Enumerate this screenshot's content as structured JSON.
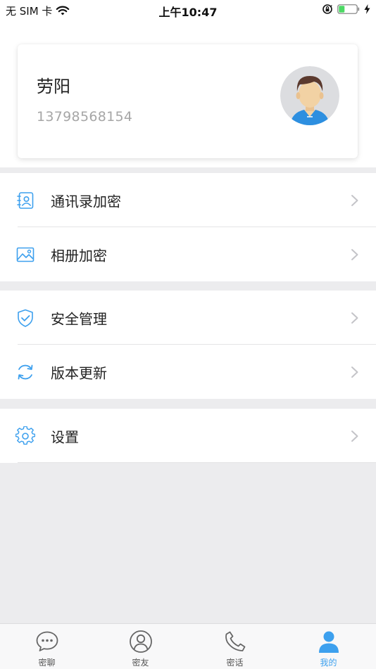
{
  "status_bar": {
    "carrier": "无 SIM 卡",
    "time": "上午10:47"
  },
  "profile": {
    "name": "劳阳",
    "phone": "13798568154"
  },
  "menu_groups": [
    [
      {
        "label": "通讯录加密",
        "icon": "contacts-icon"
      },
      {
        "label": "相册加密",
        "icon": "album-icon"
      }
    ],
    [
      {
        "label": "安全管理",
        "icon": "shield-check-icon"
      },
      {
        "label": "版本更新",
        "icon": "refresh-icon"
      }
    ],
    [
      {
        "label": "设置",
        "icon": "gear-icon"
      }
    ]
  ],
  "tabs": [
    {
      "label": "密聊",
      "icon": "chat-icon",
      "active": false
    },
    {
      "label": "密友",
      "icon": "friend-icon",
      "active": false
    },
    {
      "label": "密话",
      "icon": "phone-icon",
      "active": false
    },
    {
      "label": "我的",
      "icon": "person-icon",
      "active": true
    }
  ],
  "colors": {
    "accent": "#3da0ee",
    "background": "#ececee",
    "battery": "#4cd964"
  }
}
